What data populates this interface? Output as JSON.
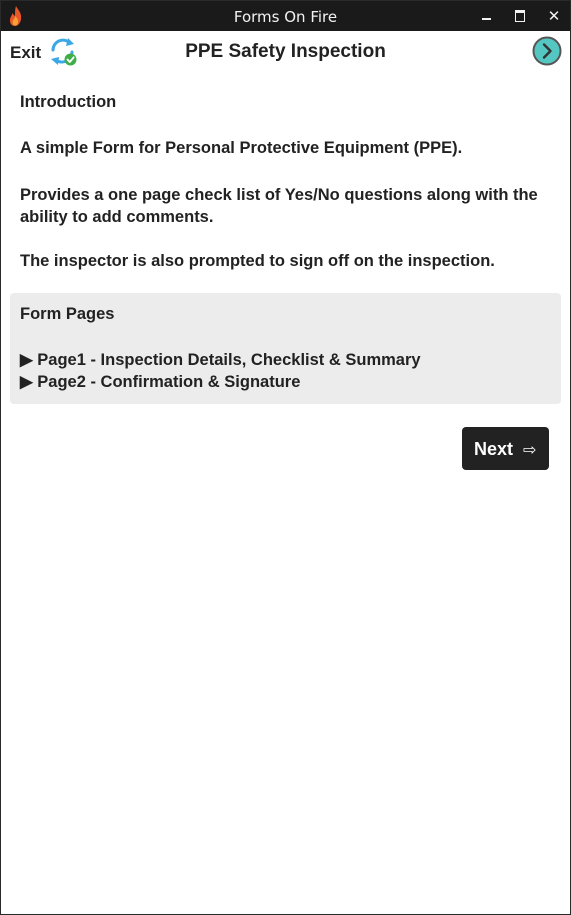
{
  "window": {
    "title": "Forms On Fire",
    "icons": {
      "app": "flame-icon",
      "minimize": "minimize-icon",
      "maximize": "maximize-icon",
      "close": "close-icon"
    },
    "close_glyph": "✕"
  },
  "header": {
    "exit_label": "Exit",
    "sync_icon": "sync-refresh-icon",
    "title": "PPE Safety Inspection",
    "next_icon": "chevron-right-circle-icon"
  },
  "intro": {
    "heading": "Introduction",
    "p1": "A simple Form for Personal Protective Equipment (PPE).",
    "p2": "Provides a one page check list of Yes/No questions along with the ability to add comments.",
    "p3": "The inspector is also prompted to sign off on the inspection."
  },
  "form_pages": {
    "heading": "Form Pages",
    "items": [
      "▶ Page1 - Inspection Details, Checklist & Summary",
      "▶ Page2 - Confirmation & Signature"
    ]
  },
  "next_button": {
    "label": "Next",
    "arrow": "⇨"
  },
  "colors": {
    "titlebar": "#1a1a1a",
    "box_background": "#ececec",
    "button": "#222222",
    "sync_blue": "#3aa7e6",
    "check_green": "#3fae49",
    "next_teal": "#55c7c2"
  }
}
